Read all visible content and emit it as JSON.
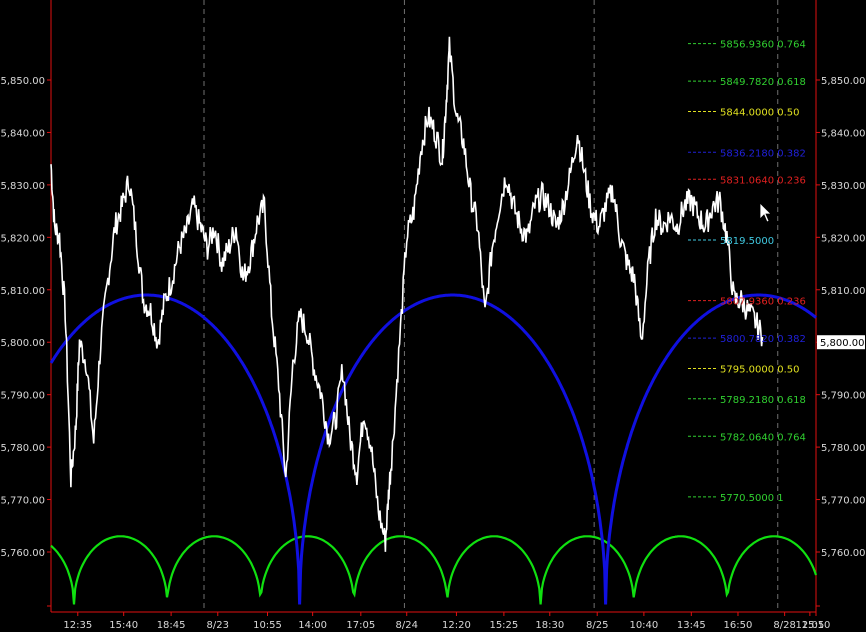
{
  "chart_data": {
    "type": "line",
    "title": "",
    "xlabel": "",
    "ylabel": "",
    "ylim": [
      5750,
      5865
    ],
    "grid": false,
    "y_ticks": [
      5760,
      5770,
      5780,
      5790,
      5800,
      5810,
      5820,
      5830,
      5840,
      5850
    ],
    "y_tick_labels": [
      "5,760.00",
      "5,770.00",
      "5,780.00",
      "5,790.00",
      "5,800.00",
      "5,810.00",
      "5,820.00",
      "5,830.00",
      "5,840.00",
      "5,850.00"
    ],
    "x_tick_labels": [
      "12:35",
      "15:40",
      "18:45",
      "8/23",
      "10:55",
      "14:00",
      "17:05",
      "8/24",
      "12:20",
      "15:25",
      "18:30",
      "8/25",
      "10:40",
      "13:45",
      "16:50",
      "8/28",
      "12:05",
      "15:10"
    ],
    "x_tick_positions": [
      0.035,
      0.095,
      0.157,
      0.218,
      0.283,
      0.342,
      0.405,
      0.465,
      0.53,
      0.592,
      0.652,
      0.714,
      0.775,
      0.837,
      0.898,
      0.959,
      0.992,
      1.0
    ],
    "day_separators": [
      0.2,
      0.462,
      0.71,
      0.95
    ],
    "current_price": {
      "value": 5800.0,
      "label": "5,800.00"
    },
    "price_series": {
      "name": "",
      "color": "#ffffff",
      "x": [
        0,
        0.005,
        0.012,
        0.02,
        0.028,
        0.035,
        0.04,
        0.05,
        0.06,
        0.07,
        0.08,
        0.09,
        0.1,
        0.11,
        0.12,
        0.13,
        0.14,
        0.15,
        0.16,
        0.17,
        0.18,
        0.19,
        0.2,
        0.21,
        0.22,
        0.23,
        0.24,
        0.25,
        0.26,
        0.27,
        0.28,
        0.29,
        0.3,
        0.31,
        0.32,
        0.33,
        0.34,
        0.35,
        0.36,
        0.37,
        0.38,
        0.39,
        0.4,
        0.41,
        0.42,
        0.43,
        0.44,
        0.45,
        0.46,
        0.47,
        0.475,
        0.48,
        0.49,
        0.5,
        0.51,
        0.52,
        0.53,
        0.54,
        0.55,
        0.555,
        0.56,
        0.57,
        0.58,
        0.59,
        0.6,
        0.61,
        0.62,
        0.63,
        0.64,
        0.65,
        0.66,
        0.67,
        0.68,
        0.69,
        0.7,
        0.71,
        0.72,
        0.73,
        0.74,
        0.75,
        0.76,
        0.77,
        0.78,
        0.79,
        0.8,
        0.81,
        0.82,
        0.83,
        0.84,
        0.85,
        0.86,
        0.87,
        0.88,
        0.89,
        0.9,
        0.91,
        0.92,
        0.93,
        0.94,
        0.95,
        0.96,
        0.97,
        0.98,
        0.99,
        1.0
      ],
      "values": [
        5834,
        5822,
        5820,
        5806,
        5774,
        5784,
        5800,
        5796,
        5781,
        5800,
        5812,
        5822,
        5826,
        5831,
        5820,
        5808,
        5806,
        5800,
        5808,
        5812,
        5818,
        5821,
        5826,
        5822,
        5818,
        5822,
        5815,
        5818,
        5822,
        5812,
        5816,
        5823,
        5826,
        5806,
        5792,
        5774,
        5796,
        5805,
        5802,
        5795,
        5790,
        5782,
        5785,
        5795,
        5782,
        5775,
        5787,
        5780,
        5768,
        5762,
        5772,
        5780,
        5800,
        5820,
        5825,
        5837,
        5843,
        5840,
        5835,
        5845,
        5856,
        5843,
        5838,
        5828,
        5822,
        5805,
        5818,
        5826,
        5832,
        5826,
        5822,
        5820,
        5826,
        5828,
        5826,
        5822,
        5826,
        5832,
        5840,
        5832,
        5825,
        5822,
        5826,
        5829,
        5820,
        5815,
        5812,
        5800,
        5815,
        5824,
        5822,
        5824,
        5822,
        5826,
        5827,
        5824,
        5822,
        5826,
        5827,
        5820,
        5808,
        5808,
        5806,
        5804,
        5801,
        5800
      ]
    },
    "arc_series": [
      {
        "name": "",
        "color": "#1010e0",
        "period_start": 0.0,
        "period_len": 0.4,
        "phase_shift": -0.075,
        "amp": 59,
        "base": 5750
      },
      {
        "name": "",
        "color": "#10e010",
        "period_len": 0.122,
        "phase_shift": 0.03,
        "amp": 13,
        "base": 5750
      }
    ],
    "fib_levels": [
      {
        "label": "5856.9360 0.764",
        "value": 5856.936,
        "color": "#30d030"
      },
      {
        "label": "5849.7820 0.618",
        "value": 5849.782,
        "color": "#30d030"
      },
      {
        "label": "5844.0000 0.50",
        "value": 5844.0,
        "color": "#e0e020"
      },
      {
        "label": "5836.2180 0.382",
        "value": 5836.218,
        "color": "#2020d8"
      },
      {
        "label": "5831.0640 0.236",
        "value": 5831.064,
        "color": "#e02020"
      },
      {
        "label": "5819.5000",
        "value": 5819.5,
        "color": "#40c8e0"
      },
      {
        "label": "5807.9360 0.236",
        "value": 5807.936,
        "color": "#e02020"
      },
      {
        "label": "5800.7820 0.382",
        "value": 5800.782,
        "color": "#2020d8"
      },
      {
        "label": "5795.0000 0.50",
        "value": 5795.0,
        "color": "#e0e020"
      },
      {
        "label": "5789.2180 0.618",
        "value": 5789.218,
        "color": "#30d030"
      },
      {
        "label": "5782.0640 0.764",
        "value": 5782.064,
        "color": "#30d030"
      },
      {
        "label": "5770.5000 1",
        "value": 5770.5,
        "color": "#30d030"
      }
    ]
  },
  "colors": {
    "axis": "#e01010",
    "background": "#000000",
    "separator": "#707070"
  }
}
